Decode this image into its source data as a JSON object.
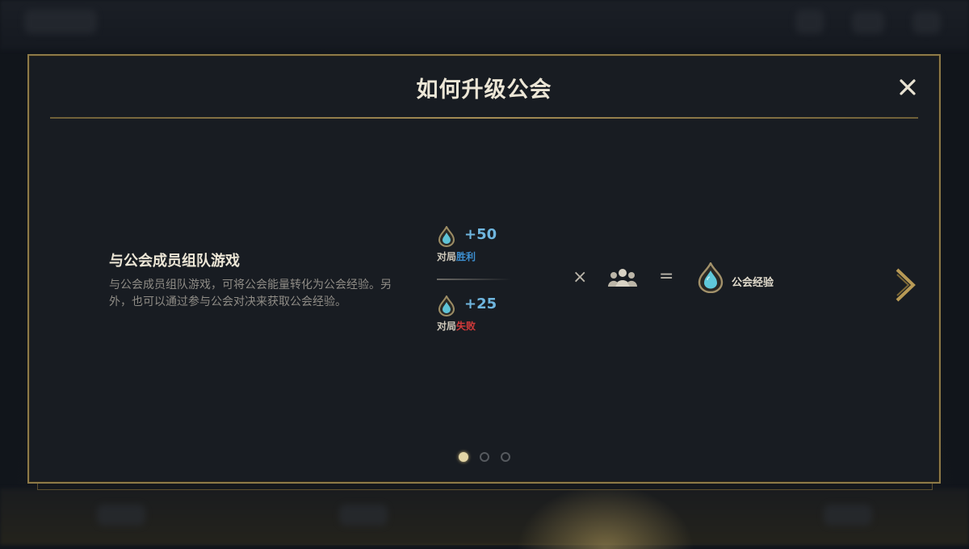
{
  "modal": {
    "title": "如何升级公会",
    "close_label": "✕"
  },
  "slide": {
    "heading": "与公会成员组队游戏",
    "description": "与公会成员组队游戏，可将公会能量转化为公会经验。另外，也可以通过参与公会对决来获取公会经验。",
    "win": {
      "amount": "+50",
      "prefix": "对局",
      "result": "胜利"
    },
    "lose": {
      "amount": "+25",
      "prefix": "对局",
      "result": "失败"
    },
    "multiply": "×",
    "equals": "=",
    "team_icon": "team-members-icon",
    "result_icon": "guild-energy-drop-icon",
    "result_label": "公会经验",
    "next_icon": "chevron-right-icon"
  },
  "pagination": {
    "current": 1,
    "total": 3
  },
  "colors": {
    "gold_border": "#8e7a48",
    "win": "#3d8fd0",
    "lose": "#d23a3a",
    "amount": "#6fb6df"
  }
}
